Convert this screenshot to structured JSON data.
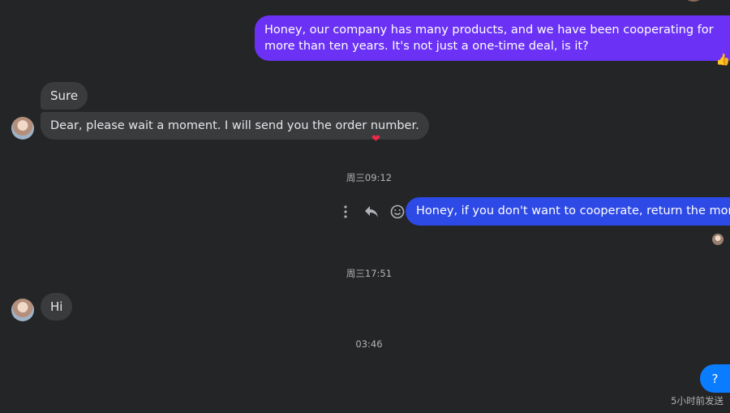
{
  "messages": {
    "outgoing_1": "Honey, our company has many products, and we have been cooperating for more than ten years. It's not just a one-time deal, is it?",
    "outgoing_1_reaction": "👍",
    "incoming_sure": "Sure",
    "incoming_dear": "Dear, please wait a moment. I will send you the order number.",
    "incoming_dear_reaction": "❤",
    "outgoing_2": "Honey, if you don't want to cooperate, return the money.",
    "incoming_hi": "Hi"
  },
  "timestamps": {
    "t1": "周三09:12",
    "t2": "周三17:51",
    "t3": "03:46"
  },
  "help_button": "?",
  "sent_status": "5小时前发送",
  "icons": {
    "more": "more-vertical-icon",
    "reply": "reply-icon",
    "react": "smiley-icon"
  },
  "colors": {
    "background": "#242526",
    "outgoing_purple": "#6b32f6",
    "outgoing_blue": "#2d49e6",
    "incoming": "#3a3b3c",
    "accent": "#0a7cff"
  }
}
